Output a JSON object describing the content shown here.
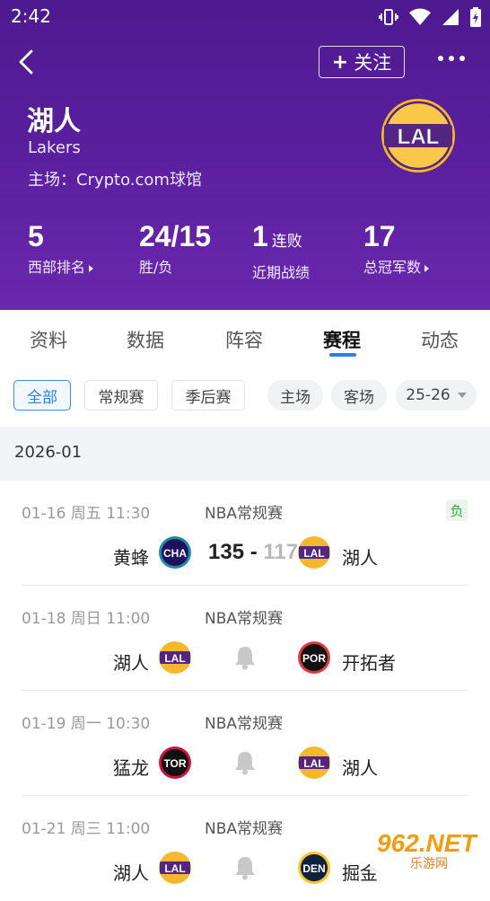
{
  "status_bar": {
    "time": "2:42"
  },
  "header": {
    "follow_label": "关注",
    "team_name": "湖人",
    "team_en": "Lakers",
    "home_venue": "主场：Crypto.com球馆",
    "logo_text": "LAL"
  },
  "stats": [
    {
      "value": "5",
      "suffix": "",
      "label": "西部排名"
    },
    {
      "value": "24/15",
      "suffix": "",
      "label": "胜/负"
    },
    {
      "value": "1",
      "suffix": "连败",
      "label": "近期战绩"
    },
    {
      "value": "17",
      "suffix": "",
      "label": "总冠军数"
    }
  ],
  "tabs": [
    "资料",
    "数据",
    "阵容",
    "赛程",
    "动态"
  ],
  "active_tab": "赛程",
  "filters": {
    "type": [
      "全部",
      "常规赛",
      "季后赛"
    ],
    "venue": [
      "主场",
      "客场"
    ],
    "season": "25-26"
  },
  "month": "2026-01",
  "games": [
    {
      "date": "01-16 周五 11:30",
      "league": "NBA常规赛",
      "left_team": "黄蜂",
      "left_logo": "CHA",
      "right_team": "湖人",
      "right_logo": "LAL",
      "score_left": "135",
      "score_right": "117",
      "result": "负"
    },
    {
      "date": "01-18 周日 11:00",
      "league": "NBA常规赛",
      "left_team": "湖人",
      "left_logo": "LAL",
      "right_team": "开拓者",
      "right_logo": "POR"
    },
    {
      "date": "01-19 周一 10:30",
      "league": "NBA常规赛",
      "left_team": "猛龙",
      "left_logo": "TOR",
      "right_team": "湖人",
      "right_logo": "LAL"
    },
    {
      "date": "01-21 周三 11:00",
      "league": "NBA常规赛",
      "left_team": "湖人",
      "left_logo": "LAL",
      "right_team": "掘金",
      "right_logo": "DEN"
    }
  ],
  "watermark": {
    "text": "962.NET",
    "sub": "乐游网"
  },
  "colors": {
    "header": "#5a1f9e",
    "accent": "#2b7fe0",
    "lakers_gold": "#f4b82a",
    "lakers_purple": "#552583"
  }
}
